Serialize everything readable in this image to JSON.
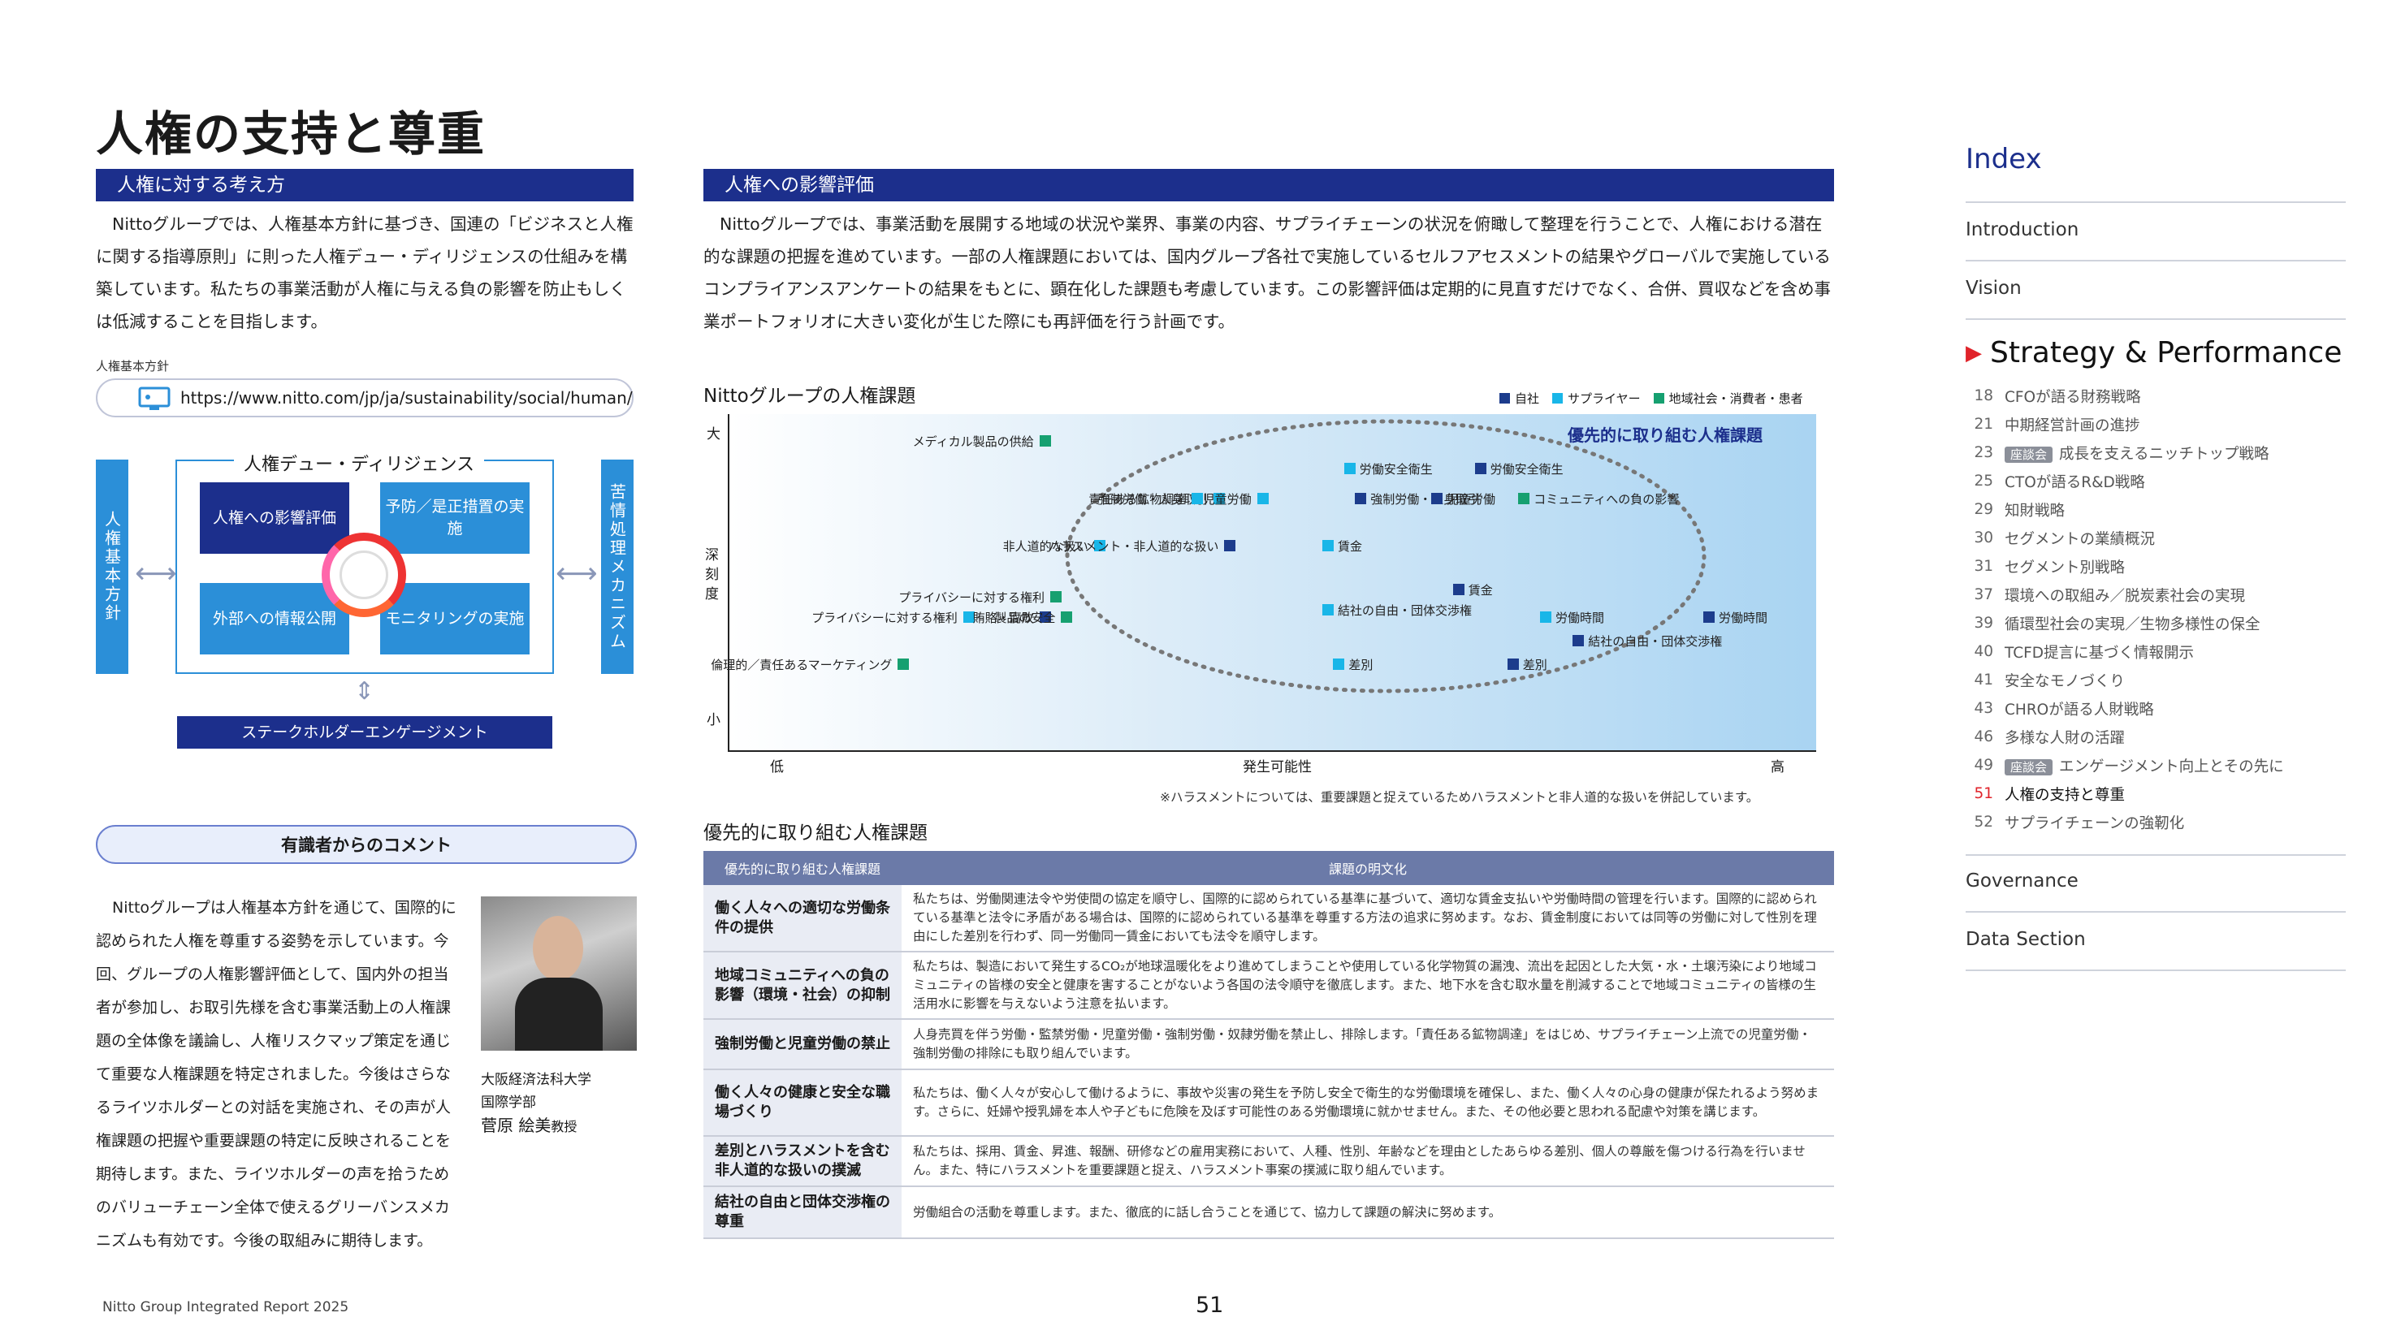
{
  "page_title": "人権の支持と尊重",
  "left": {
    "sec1": "人権に対する考え方",
    "sec1_text": "Nittoグループでは、人権基本方針に基づき、国連の「ビジネスと人権に関する指導原則」に則った人権デュー・ディリジェンスの仕組みを構築しています。私たちの事業活動が人権に与える負の影響を防止もしくは低減することを目指します。",
    "policy_label": "人権基本方針",
    "url": "https://www.nitto.com/jp/ja/sustainability/social/human/",
    "diagram": {
      "dd_title": "人権デュー・ディリジェンス",
      "left_bar": "人権基本方針",
      "right_bar": "苦情処理メカニズム",
      "b1": "人権への影響評価",
      "b2": "予防／是正措置の実施",
      "b3": "外部への情報公開",
      "b4": "モニタリングの実施",
      "bottom": "ステークホルダーエンゲージメント"
    },
    "comment_title": "有識者からのコメント",
    "comment_text": "Nittoグループは人権基本方針を通じて、国際的に認められた人権を尊重する姿勢を示しています。今回、グループの人権影響評価として、国内外の担当者が参加し、お取引先様を含む事業活動上の人権課題の全体像を議論し、人権リスクマップ策定を通じて重要な人権課題を特定されました。今後はさらなるライツホルダーとの対話を実施され、その声が人権課題の把握や重要課題の特定に反映されることを期待します。また、ライツホルダーの声を拾うためのバリューチェーン全体で使えるグリーバンスメカニズムも有効です。今後の取組みに期待します。",
    "univ": "大阪経済法科大学",
    "faculty": "国際学部",
    "person": "菅原 絵美",
    "person_title": "教授"
  },
  "middle": {
    "sec2": "人権への影響評価",
    "sec2_text": "Nittoグループでは、事業活動を展開する地域の状況や業界、事業の内容、サプライチェーンの状況を俯瞰して整理を行うことで、人権における潜在的な課題の把握を進めています。一部の人権課題においては、国内グループ各社で実施しているセルフアセスメントの結果やグローバルで実施しているコンプライアンスアンケートの結果をもとに、顕在化した課題も考慮しています。この影響評価は定期的に見直すだけでなく、合併、買収などを含め事業ポートフォリオに大きい変化が生じた際にも再評価を行う計画です。",
    "chart_heading": "Nittoグループの人権課題",
    "note": "※ハラスメントについては、重要課題と捉えているためハラスメントと非人道的な扱いを併記しています。",
    "table_heading": "優先的に取り組む人権課題",
    "table_headers": [
      "優先的に取り組む人権課題",
      "課題の明文化"
    ],
    "rows": [
      {
        "k": "働く人々への適切な労働条件の提供",
        "v": "私たちは、労働関連法令や労使間の協定を順守し、国際的に認められている基準に基づいて、適切な賃金支払いや労働時間の管理を行います。国際的に認められている基準と法令に矛盾がある場合は、国際的に認められている基準を尊重する方法の追求に努めます。なお、賃金制度においては同等の労働に対して性別を理由にした差別を行わず、同一労働同一賃金においても法令を順守します。"
      },
      {
        "k": "地域コミュニティへの負の影響（環境・社会）の抑制",
        "v": "私たちは、製造において発生するCO₂が地球温暖化をより進めてしまうことや使用している化学物質の漏洩、流出を起因とした大気・水・土壌汚染により地域コミュニティの皆様の安全と健康を害することがないよう各国の法令順守を徹底します。また、地下水を含む取水量を削減することで地域コミュニティの皆様の生活用水に影響を与えないよう注意を払います。"
      },
      {
        "k": "強制労働と児童労働の禁止",
        "v": "人身売買を伴う労働・監禁労働・児童労働・強制労働・奴隷労働を禁止し、排除します。「責任ある鉱物調達」をはじめ、サプライチェーン上流での児童労働・強制労働の排除にも取り組んでいます。"
      },
      {
        "k": "働く人々の健康と安全な職場づくり",
        "v": "私たちは、働く人々が安心して働けるように、事故や災害の発生を予防し安全で衛生的な労働環境を確保し、また、働く人々の心身の健康が保たれるよう努めます。さらに、妊婦や授乳婦を本人や子どもに危険を及ぼす可能性のある労働環境に就かせません。また、その他必要と思われる配慮や対策を講じます。"
      },
      {
        "k": "差別とハラスメントを含む非人道的な扱いの撲滅",
        "v": "私たちは、採用、賃金、昇進、報酬、研修などの雇用実務において、人種、性別、年齢などを理由としたあらゆる差別、個人の尊厳を傷つける行為を行いません。また、特にハラスメントを重要課題と捉え、ハラスメント事案の撲滅に取り組んでいます。"
      },
      {
        "k": "結社の自由と団体交渉権の尊重",
        "v": "労働組合の活動を尊重します。また、徹底的に話し合うことを通じて、協力して課題の解決に努めます。"
      }
    ]
  },
  "chart_data": {
    "type": "scatter",
    "title": "Nittoグループの人権課題",
    "xlabel": "発生可能性",
    "x_low": "低",
    "x_high": "高",
    "ylabel": "深刻度",
    "y_high": "大",
    "y_low": "小",
    "priority_label": "優先的に取り組む人権課題",
    "legend": [
      {
        "name": "自社",
        "color": "#1c3c8c"
      },
      {
        "name": "サプライヤー",
        "color": "#19b6e8"
      },
      {
        "name": "地域社会・消費者・患者",
        "color": "#16a070"
      }
    ],
    "xlim": [
      0,
      100
    ],
    "ylim": [
      0,
      100
    ],
    "points": [
      {
        "label": "メディカル製品の供給",
        "x": 29,
        "y": 92,
        "series": 2
      },
      {
        "label": "労働安全衛生",
        "x": 57,
        "y": 84,
        "series": 1
      },
      {
        "label": "労働安全衛生",
        "x": 69,
        "y": 84,
        "series": 0
      },
      {
        "label": "強制労働・人身取引",
        "x": 45,
        "y": 75,
        "series": 1
      },
      {
        "label": "強制労働・人身取引",
        "x": 58,
        "y": 75,
        "series": 0
      },
      {
        "label": "責任ある鉱物調達",
        "x": 43,
        "y": 75,
        "series": 1
      },
      {
        "label": "児童労働",
        "x": 49,
        "y": 75,
        "series": 1
      },
      {
        "label": "児童労働",
        "x": 65,
        "y": 75,
        "series": 0
      },
      {
        "label": "コミュニティへの負の影響",
        "x": 73,
        "y": 75,
        "series": 2
      },
      {
        "label": "非人道的な扱い",
        "x": 34,
        "y": 61,
        "series": 1
      },
      {
        "label": "賃金",
        "x": 55,
        "y": 61,
        "series": 1
      },
      {
        "label": "ハラスメント・非人道的な扱い",
        "x": 46,
        "y": 61,
        "series": 0
      },
      {
        "label": "プライバシーに対する権利",
        "x": 30,
        "y": 46,
        "series": 2
      },
      {
        "label": "賃金",
        "x": 67,
        "y": 48,
        "series": 0
      },
      {
        "label": "結社の自由・団体交渉権",
        "x": 55,
        "y": 42,
        "series": 1
      },
      {
        "label": "労働時間",
        "x": 75,
        "y": 40,
        "series": 1
      },
      {
        "label": "労働時間",
        "x": 90,
        "y": 40,
        "series": 0
      },
      {
        "label": "プライバシーに対する権利",
        "x": 22,
        "y": 40,
        "series": 1
      },
      {
        "label": "賄賂・腐敗",
        "x": 29,
        "y": 40,
        "series": 0
      },
      {
        "label": "製品の安全",
        "x": 31,
        "y": 40,
        "series": 2
      },
      {
        "label": "倫理的／責任あるマーケティング",
        "x": 16,
        "y": 26,
        "series": 2
      },
      {
        "label": "差別",
        "x": 56,
        "y": 26,
        "series": 1
      },
      {
        "label": "差別",
        "x": 72,
        "y": 26,
        "series": 0
      },
      {
        "label": "結社の自由・団体交渉権",
        "x": 78,
        "y": 33,
        "series": 0
      }
    ]
  },
  "index": {
    "title": "Index",
    "top": [
      "Introduction",
      "Vision"
    ],
    "active": "Strategy & Performance",
    "subs": [
      {
        "n": "18",
        "t": "CFOが語る財務戦略"
      },
      {
        "n": "21",
        "t": "中期経営計画の進捗"
      },
      {
        "n": "23",
        "tag": "座談会",
        "t": "成長を支えるニッチトップ戦略"
      },
      {
        "n": "25",
        "t": "CTOが語るR&D戦略"
      },
      {
        "n": "29",
        "t": "知財戦略"
      },
      {
        "n": "30",
        "t": "セグメントの業績概況"
      },
      {
        "n": "31",
        "t": "セグメント別戦略"
      },
      {
        "n": "37",
        "t": "環境への取組み／脱炭素社会の実現"
      },
      {
        "n": "39",
        "t": "循環型社会の実現／生物多様性の保全"
      },
      {
        "n": "40",
        "t": "TCFD提言に基づく情報開示"
      },
      {
        "n": "41",
        "t": "安全なモノづくり"
      },
      {
        "n": "43",
        "t": "CHROが語る人財戦略"
      },
      {
        "n": "46",
        "t": "多様な人財の活躍"
      },
      {
        "n": "49",
        "tag": "座談会",
        "t": "エンゲージメント向上とその先に"
      },
      {
        "n": "51",
        "t": "人権の支持と尊重",
        "current": true
      },
      {
        "n": "52",
        "t": "サプライチェーンの強靭化"
      }
    ],
    "bottom": [
      "Governance",
      "Data Section"
    ]
  },
  "footer": {
    "left": "Nitto Group Integrated Report 2025",
    "page": "51"
  }
}
